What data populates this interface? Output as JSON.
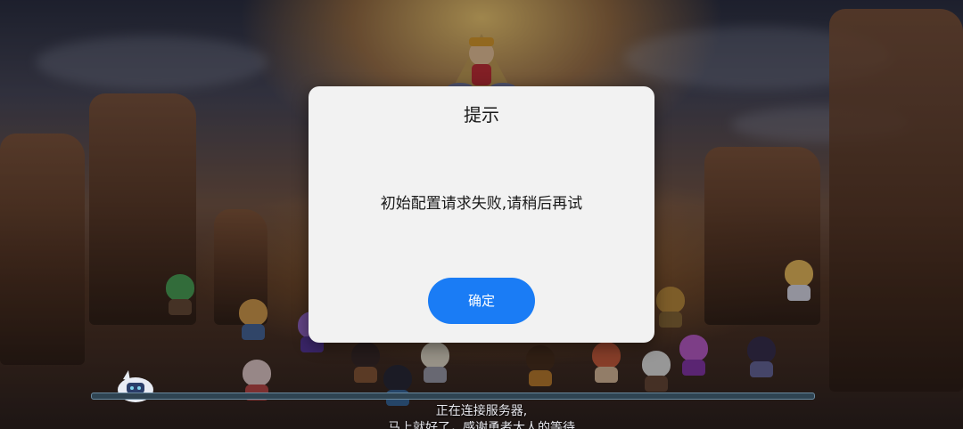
{
  "dialog": {
    "title": "提示",
    "message": "初始配置请求失败,请稍后再试",
    "confirm_label": "确定",
    "accent_color": "#1a7cf5",
    "background_color": "#f2f2f2"
  },
  "loading": {
    "line1": "正在连接服务器,",
    "line2": "马上就好了，感谢勇者大人的等待",
    "progress": 0.0
  }
}
